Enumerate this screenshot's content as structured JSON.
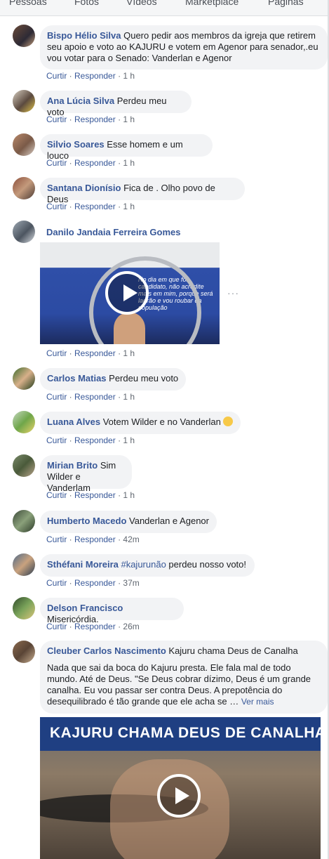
{
  "tabs": [
    "Pessoas",
    "Fotos",
    "Vídeos",
    "Marketplace",
    "Páginas"
  ],
  "actions": {
    "like": "Curtir",
    "reply": "Responder",
    "sep": " · "
  },
  "comments": [
    {
      "author": "Bispo Hélio Silva",
      "text_1": " Quero pedir aos membros da igreja que retirem",
      "text_2": "seu apoio e voto ao KAJURU e votem em Agenor para senador,.eu",
      "text_3": "vou votar para o Senado: Vanderlan e Agenor",
      "time": "1 h"
    },
    {
      "author": "Ana Lúcia Silva",
      "text": " Perdeu meu voto",
      "time": "1 h"
    },
    {
      "author": "Silvio Soares",
      "text": " Esse homem e um louco",
      "time": "1 h"
    },
    {
      "author": "Santana Dionísio",
      "text": " Fica de . Olho povo de Deus",
      "time": "1 h"
    },
    {
      "author": "Danilo Jandaia Ferreira Gomes",
      "time": "1 h",
      "video_text": "No dia em que for candidato, não acredite mais em mim, porque será ladrão e vou roubar da população",
      "more": "···"
    },
    {
      "author": "Carlos Matias",
      "text": " Perdeu meu voto",
      "time": "1 h"
    },
    {
      "author": "Luana Alves",
      "text": " Votem Wilder e no Vanderlan ",
      "time": "1 h"
    },
    {
      "author": "Mirian Brito",
      "text": " Sim",
      "text_2": "Wilder e Vanderlam",
      "time": "1 h"
    },
    {
      "author": "Humberto Macedo",
      "text": " Vanderlan e Agenor",
      "time": "42m"
    },
    {
      "author": "Sthéfani Moreira",
      "hashtag": " #kajurunão",
      "text": " perdeu nosso voto!",
      "time": "37m"
    },
    {
      "author": "Delson Francisco",
      "text": " Misericórdia.",
      "time": "26m"
    },
    {
      "author": "Cleuber Carlos Nascimento",
      "text": " Kajuru chama Deus de Canalha",
      "body_1": "Nada que sai da boca do Kajuru presta. Ele fala mal de todo",
      "body_2": "mundo. Até de Deus. \"Se Deus cobrar dízimo, Deus é um grande",
      "body_3": "canalha. Eu vou passar ser contra Deus. A prepotência do",
      "body_4": "desequilibrado é tão grande que ele acha se … ",
      "see_more": "Ver mais",
      "video_title": "KAJURU  CHAMA DEUS DE CANALHA"
    }
  ],
  "colors": {
    "link": "#385898",
    "bubble": "#f2f3f5",
    "meta": "#606770"
  }
}
